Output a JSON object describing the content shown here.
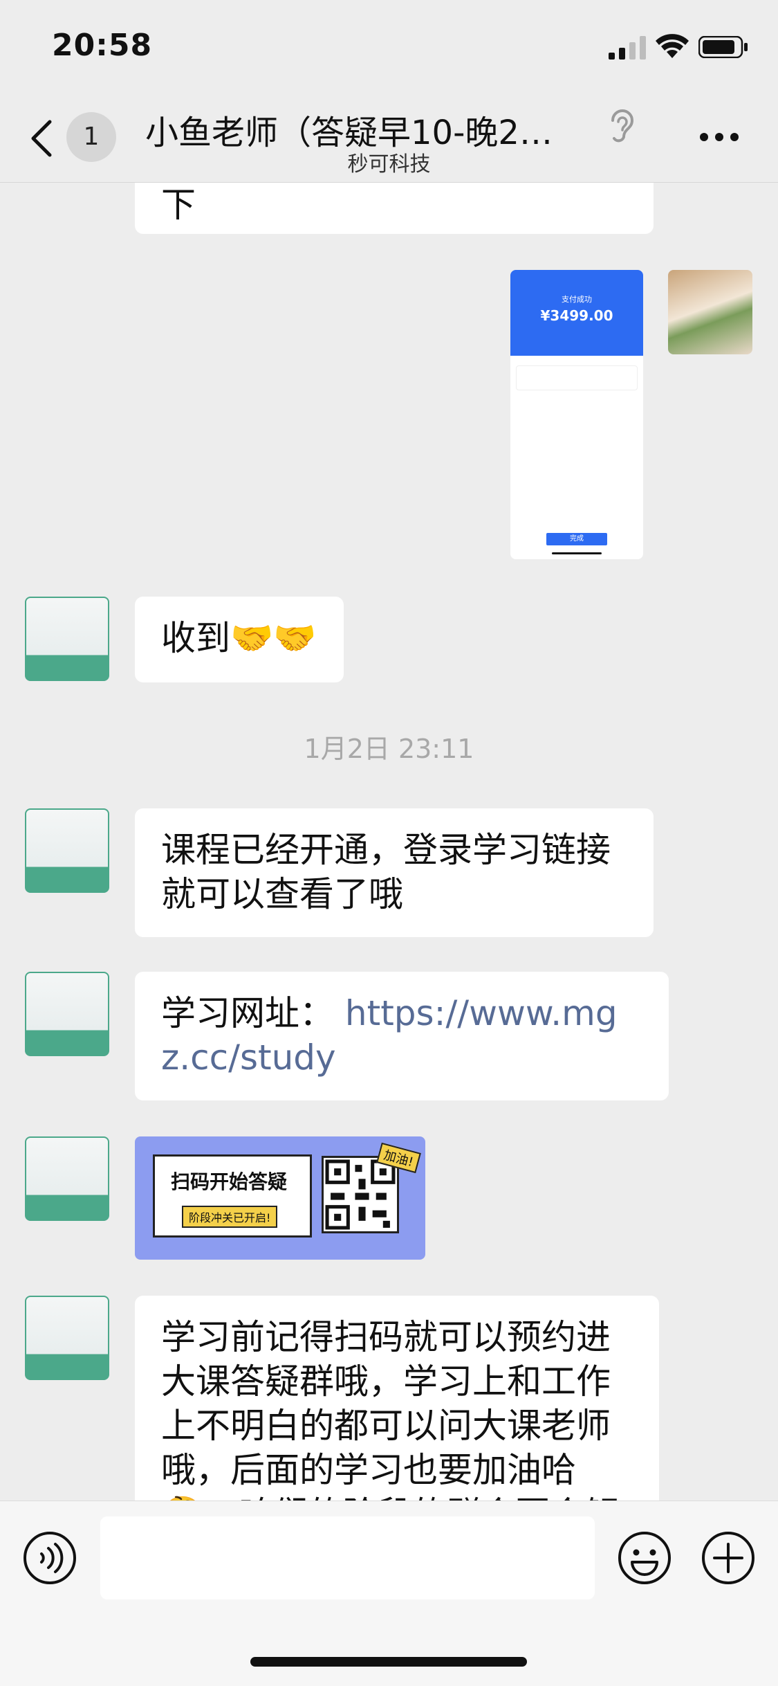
{
  "status_bar": {
    "time": "20:58"
  },
  "header": {
    "unread_count": "1",
    "title": "小鱼老师（答疑早10-晚2…",
    "subtitle": "秒可科技"
  },
  "messages": {
    "partial_top_text": "下",
    "payment_card": {
      "amount": "¥3499.00",
      "status": "支付成功",
      "done": "完成"
    },
    "received": {
      "text": "收到",
      "emoji": "🤝🤝"
    },
    "timestamp": "1月2日 23:11",
    "course_opened": "课程已经开通，登录学习链接就可以查看了哦",
    "study_url_label": "学习网址：",
    "study_url_link": "https://www.mgz.cc/study",
    "qr_card": {
      "title": "扫码开始答疑",
      "subtitle": "阶段冲关已开启!",
      "tag": "加油!"
    },
    "reminder": "学习前记得扫码就可以预约进大课答疑群哦，学习上和工作上不明白的都可以问大课老师哦，后面的学习也要加油哈🤔",
    "reminder_overflow": "，咱们的阶段的群会要会解散"
  },
  "avatar": {
    "caption": "小鱼老师"
  },
  "colors": {
    "link": "#576b95",
    "accent": "#4ba88a"
  }
}
